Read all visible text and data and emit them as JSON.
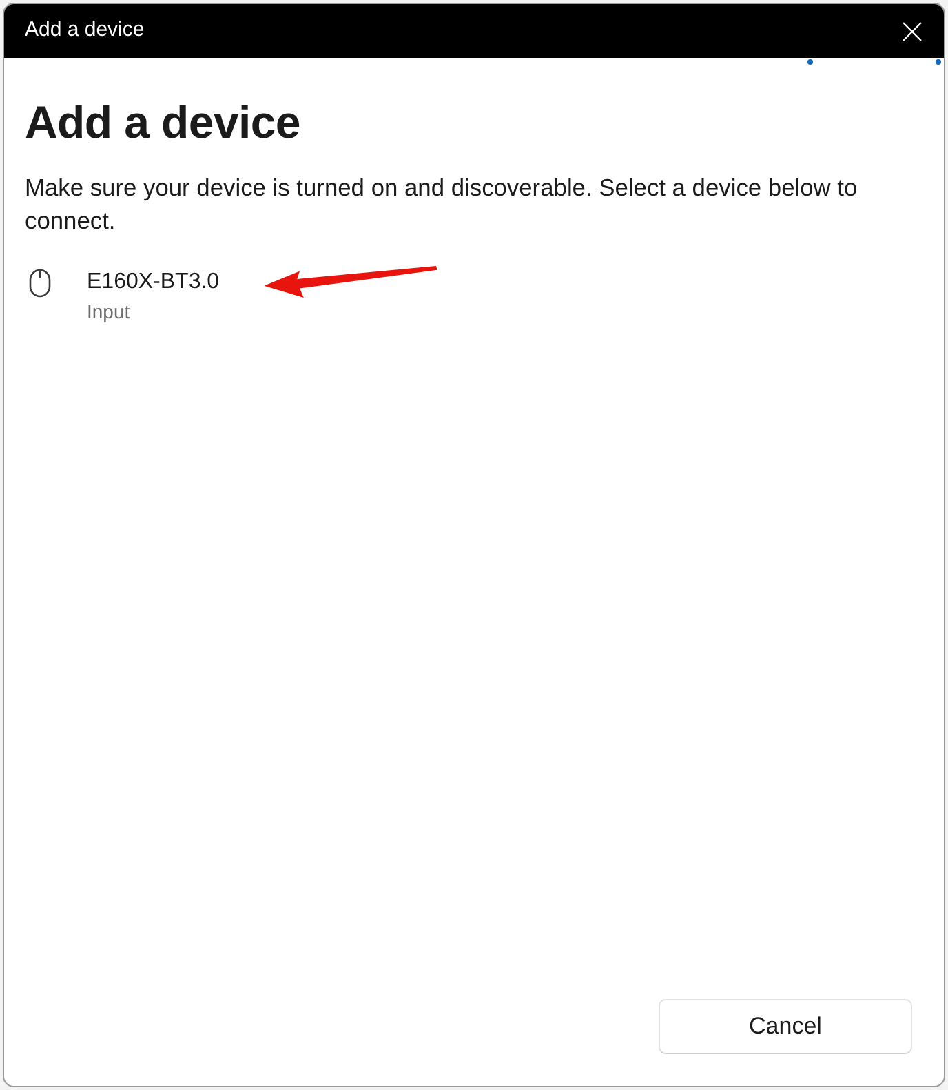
{
  "window": {
    "title": "Add a device"
  },
  "searching": true,
  "heading": "Add a device",
  "instructions": "Make sure your device is turned on and discoverable. Select a device below to connect.",
  "devices": [
    {
      "kind": "mouse",
      "name": "E160X-BT3.0",
      "category": "Input"
    }
  ],
  "annotations": [
    {
      "kind": "arrow"
    }
  ],
  "buttons": [
    "Cancel"
  ]
}
